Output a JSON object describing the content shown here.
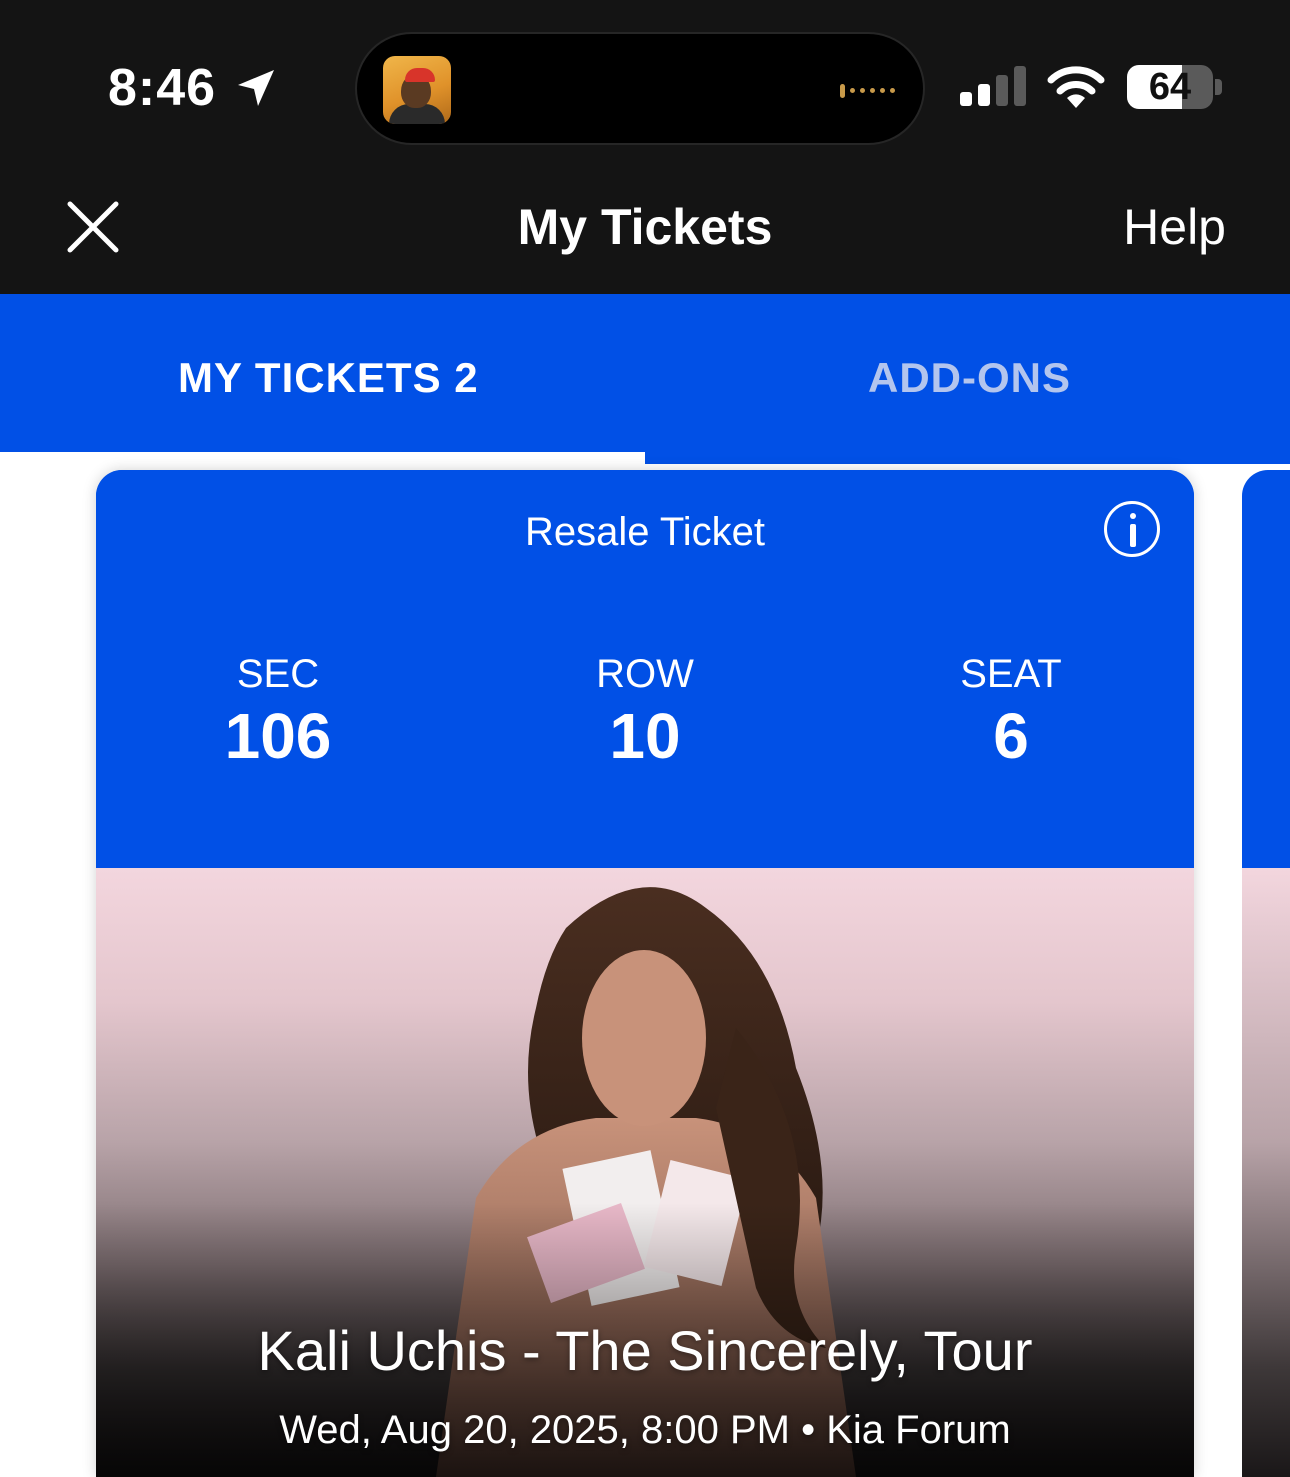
{
  "status_bar": {
    "time": "8:46",
    "battery": "64",
    "battery_level": 0.64
  },
  "nav": {
    "title": "My Tickets",
    "help_label": "Help"
  },
  "tabs": [
    {
      "label": "MY TICKETS 2",
      "active": true
    },
    {
      "label": "ADD-ONS",
      "active": false
    }
  ],
  "ticket": {
    "type_label": "Resale Ticket",
    "section_label": "SEC",
    "section": "106",
    "row_label": "ROW",
    "row": "10",
    "seat_label": "SEAT",
    "seat": "6",
    "event_name": "Kali Uchis - The Sincerely, Tour",
    "event_details": "Wed, Aug 20, 2025, 8:00 PM • Kia Forum"
  },
  "colors": {
    "brand_blue": "#0150e6",
    "top_bar": "#141414"
  }
}
